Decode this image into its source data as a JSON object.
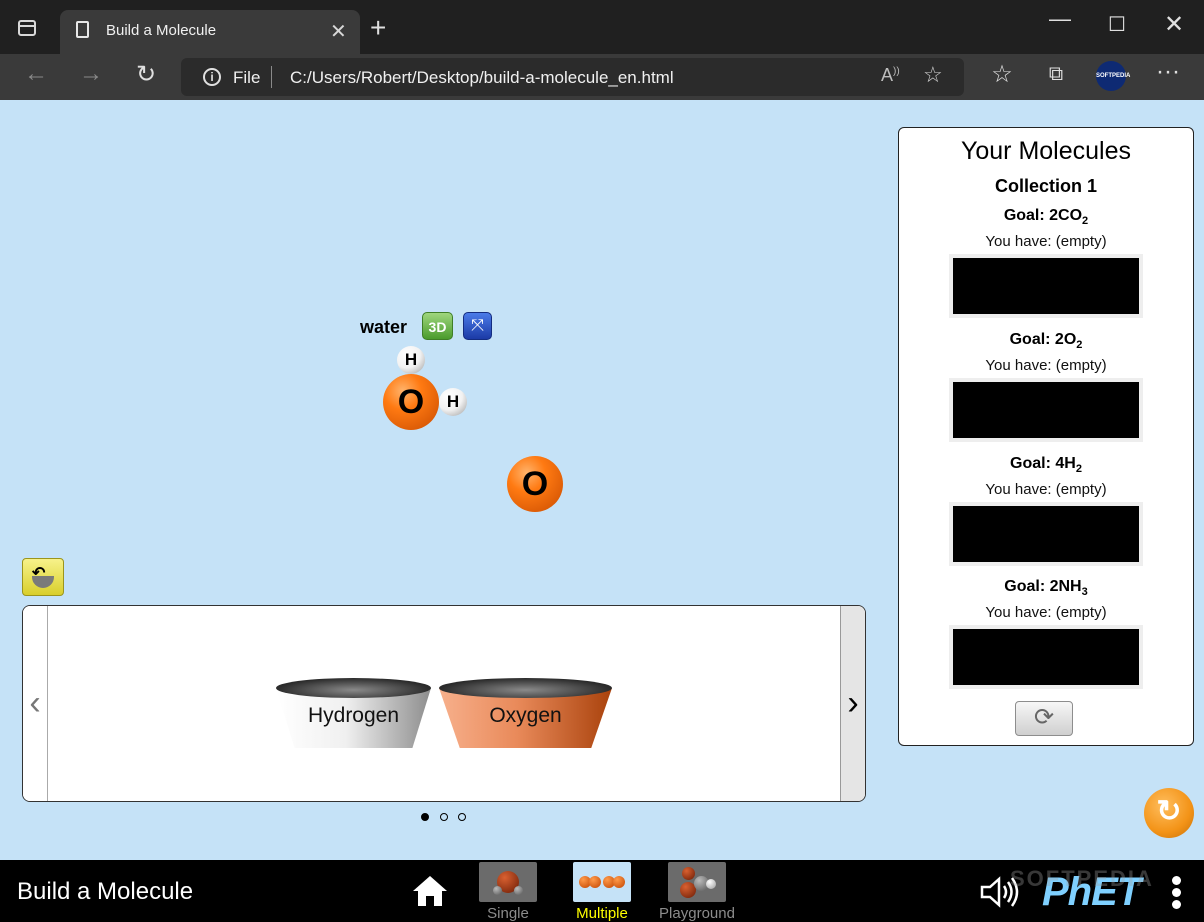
{
  "browser": {
    "tab_title": "Build a Molecule",
    "address_scheme_label": "File",
    "url": "C:/Users/Robert/Desktop/build-a-molecule_en.html",
    "profile_badge": "SOFTPEDIA"
  },
  "play_area": {
    "molecule_label": "water",
    "view_3d_label": "3D",
    "atoms": [
      {
        "symbol": "O",
        "element": "oxygen"
      },
      {
        "symbol": "H",
        "element": "hydrogen"
      },
      {
        "symbol": "H",
        "element": "hydrogen"
      },
      {
        "symbol": "O",
        "element": "oxygen"
      }
    ]
  },
  "kit": {
    "buckets": [
      {
        "label": "Hydrogen",
        "color": "#e8e8e8"
      },
      {
        "label": "Oxygen",
        "color": "#e98a5a"
      }
    ],
    "prev_glyph": "‹",
    "next_glyph": "›",
    "page_count": 3,
    "current_page": 1
  },
  "collection": {
    "title": "Your Molecules",
    "name": "Collection 1",
    "goals": [
      {
        "prefix": "Goal: 2CO",
        "subscript": "2",
        "have": "You have: (empty)"
      },
      {
        "prefix": "Goal: 2O",
        "subscript": "2",
        "have": "You have: (empty)"
      },
      {
        "prefix": "Goal: 4H",
        "subscript": "2",
        "have": "You have: (empty)"
      },
      {
        "prefix": "Goal: 2NH",
        "subscript": "3",
        "have": "You have: (empty)"
      }
    ]
  },
  "navbar": {
    "sim_title": "Build a Molecule",
    "screens": [
      {
        "label": "Single",
        "selected": false
      },
      {
        "label": "Multiple",
        "selected": true
      },
      {
        "label": "Playground",
        "selected": false
      }
    ],
    "logo": "PhET",
    "watermark": "SOFTPEDIA"
  },
  "colors": {
    "sim_background": "#c5e2f7",
    "selected_screen_label": "#ffff00",
    "oxygen": "#ff7a12",
    "hydrogen": "#ffffff"
  }
}
